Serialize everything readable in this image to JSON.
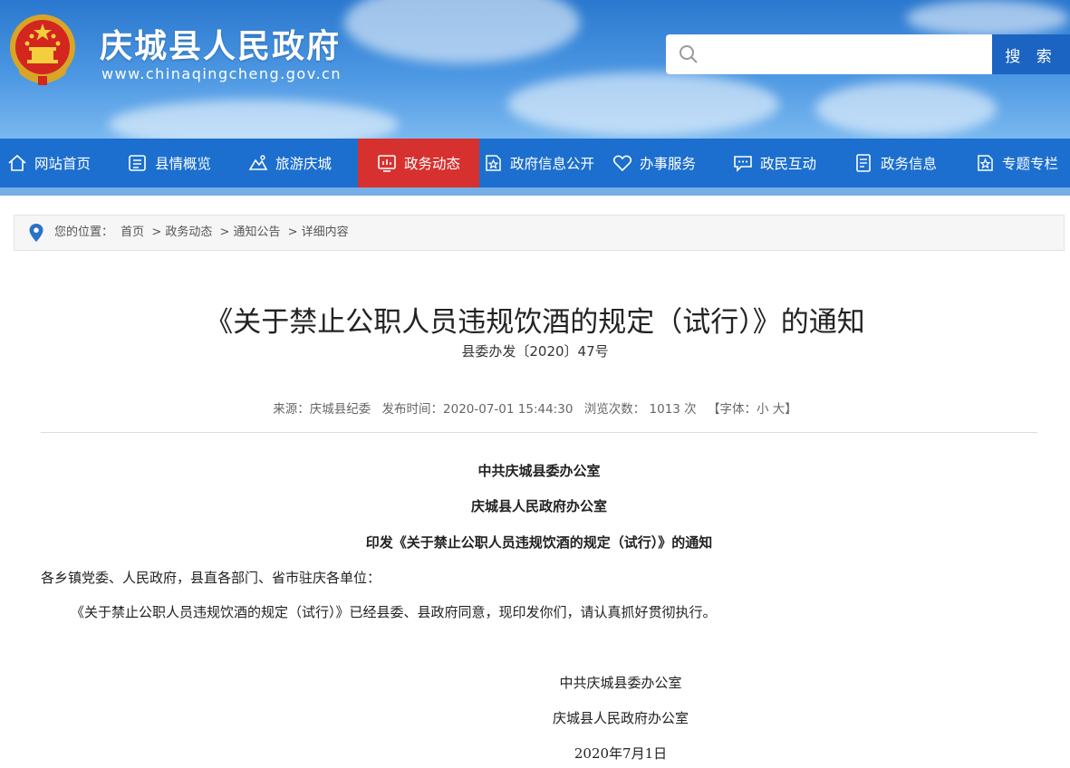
{
  "header": {
    "site_title": "庆城县人民政府",
    "site_url": "www.chinaqingcheng.gov.cn",
    "search_placeholder": "",
    "search_button": "搜 索"
  },
  "nav": {
    "items": [
      {
        "label": "网站首页",
        "icon": "home-icon"
      },
      {
        "label": "县情概览",
        "icon": "document-list-icon"
      },
      {
        "label": "旅游庆城",
        "icon": "mountain-icon"
      },
      {
        "label": "政务动态",
        "icon": "chart-screen-icon",
        "active": true
      },
      {
        "label": "政府信息公开",
        "icon": "star-document-icon"
      },
      {
        "label": "办事服务",
        "icon": "heart-hand-icon"
      },
      {
        "label": "政民互动",
        "icon": "chat-icon"
      },
      {
        "label": "政务信息",
        "icon": "file-info-icon"
      },
      {
        "label": "专题专栏",
        "icon": "star-file-icon"
      }
    ],
    "active_color": "#d6312f",
    "bar_color": "#1c6fce"
  },
  "breadcrumb": {
    "prefix": "您的位置：",
    "items": [
      "首页",
      "> 政务动态",
      "> 通知公告",
      "> 详细内容"
    ]
  },
  "article": {
    "title": "《关于禁止公职人员违规饮酒的规定（试行）》的通知",
    "doc_number": "县委办发〔2020〕47号",
    "meta": {
      "source": "来源：庆城县纪委",
      "publish_time": "发布时间：2020-07-01 15:44:30",
      "views": "浏览次数： 1013  次",
      "font_size": "【字体：小 大】"
    },
    "header_lines": [
      "中共庆城县委办公室",
      "庆城县人民政府办公室",
      "印发《关于禁止公职人员违规饮酒的规定（试行）》的通知"
    ],
    "addressee": "各乡镇党委、人民政府，县直各部门、省市驻庆各单位：",
    "paragraph": "《关于禁止公职人员违规饮酒的规定（试行）》已经县委、县政府同意，现印发你们，请认真抓好贯彻执行。",
    "signature": [
      "中共庆城县委办公室",
      "庆城县人民政府办公室",
      "2020年7月1日"
    ]
  }
}
